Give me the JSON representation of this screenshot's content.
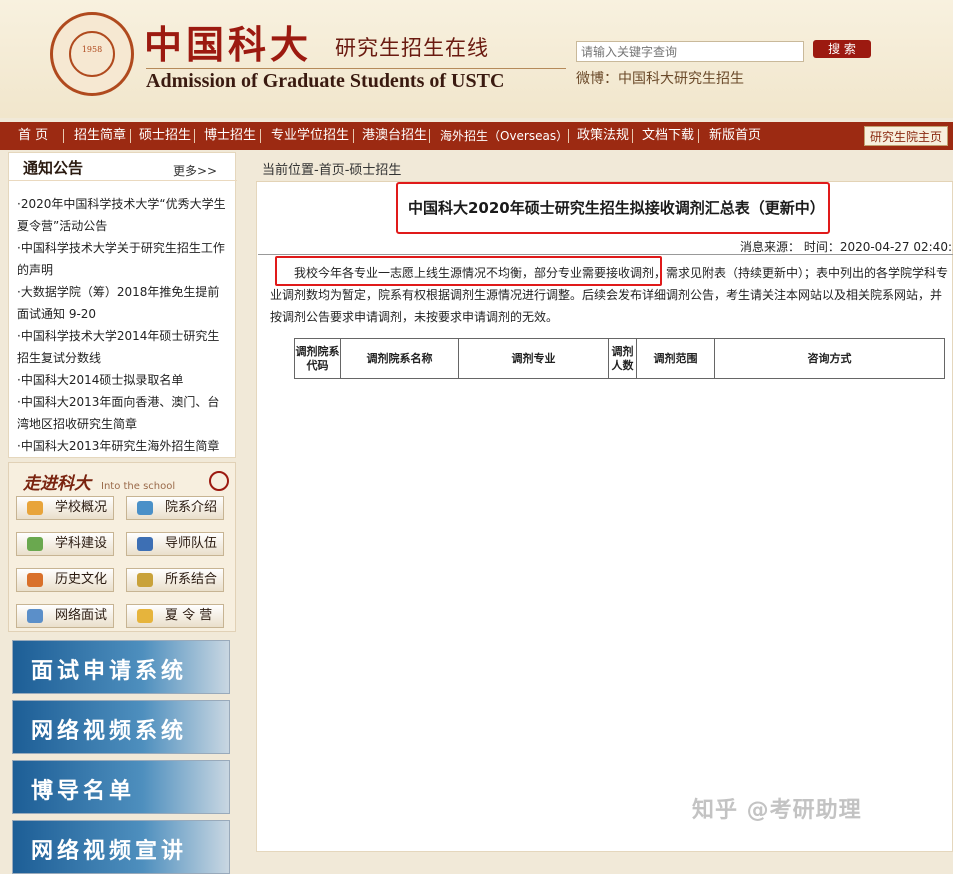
{
  "header": {
    "cn_name": "中国科大",
    "cn_sub": "研究生招生在线",
    "en_name": "Admission of Graduate Students of USTC",
    "logo_year": "1958",
    "search_placeholder": "请输入关键字查询",
    "search_button": "搜 索",
    "weibo": "微博：中国科大研究生招生"
  },
  "nav": {
    "items": [
      "首 页",
      "招生简章",
      "硕士招生",
      "博士招生",
      "专业学位招生",
      "港澳台招生",
      "海外招生（Overseas）",
      "政策法规",
      "文档下载",
      "新版首页"
    ],
    "right": "研究生院主页"
  },
  "notice": {
    "title": "通知公告",
    "more": "更多>>",
    "items": [
      "·2020年中国科学技术大学“优秀大学生夏令营”活动公告",
      "·中国科学技术大学关于研究生招生工作的声明",
      "·大数据学院（筹）2018年推免生提前面试通知 9-20",
      "·中国科学技术大学2014年硕士研究生招生复试分数线",
      "·中国科大2014硕士拟录取名单",
      "·中国科大2013年面向香港、澳门、台湾地区招收研究生简章",
      "·中国科大2013年研究生海外招生简章"
    ]
  },
  "enter": {
    "title": "走进科大",
    "sub": "Into the school",
    "buttons": [
      "学校概况",
      "院系介绍",
      "学科建设",
      "导师队伍",
      "历史文化",
      "所系结合",
      "网络面试",
      "夏 令 营"
    ]
  },
  "banners": [
    "面试申请系统",
    "网络视频系统",
    "博导名单",
    "网络视频宣讲"
  ],
  "article": {
    "crumb": "当前位置-首页-硕士招生",
    "title": "中国科大2020年硕士研究生招生拟接收调剂汇总表（更新中）",
    "meta": "消息来源：  时间：2020-04-27 02:40:5",
    "intro": "我校今年各专业一志愿上线生源情况不均衡，部分专业需要接收调剂，需求见附表（持续更新中）；表中列出的各学院学科专业调剂数均为暂定，院系有权根据调剂生源情况进行调整。后续会发布详细调剂公告，考生请关注本网站以及相关院系网站，并按调剂公告要求申请调剂，未按要求申请调剂的无效。"
  },
  "table": {
    "headers": [
      "调剂院系代码",
      "调剂院系名称",
      "调剂专业",
      "调剂人数",
      "调剂范围",
      "咨询方式"
    ]
  },
  "watermark": "知乎 @考研助理"
}
